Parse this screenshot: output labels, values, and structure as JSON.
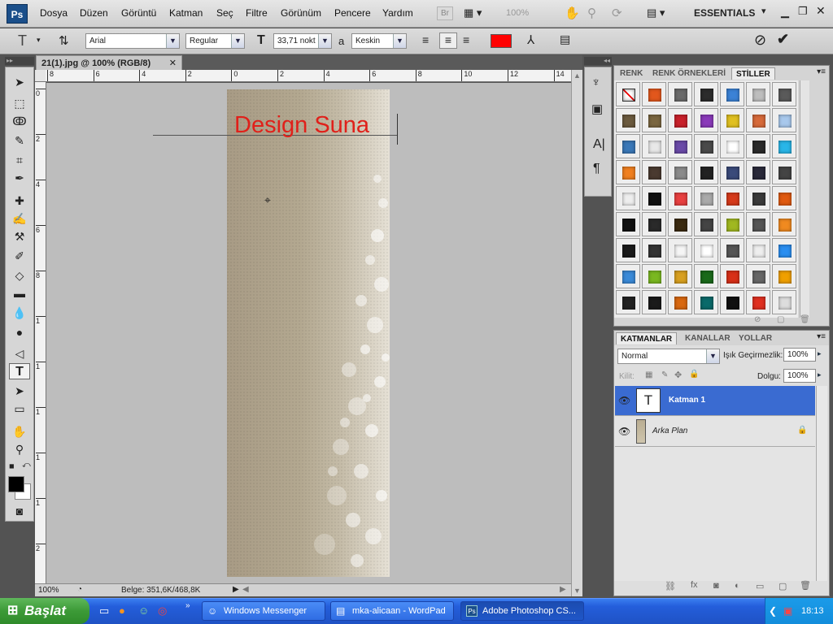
{
  "menubar": {
    "logo": "Ps",
    "items": [
      "Dosya",
      "Düzen",
      "Görüntü",
      "Katman",
      "Seç",
      "Filtre",
      "Görünüm",
      "Pencere",
      "Yardım"
    ],
    "zoom": "100%",
    "workspace": "ESSENTIALS"
  },
  "options": {
    "font_family": "Arial",
    "font_style": "Regular",
    "font_size": "33,71 nokt",
    "antialias_label": "a",
    "antialias": "Keskin",
    "text_color": "#ff0000"
  },
  "document": {
    "tab_title": "21(1).jpg @ 100% (RGB/8)",
    "overlay_text": "Design Suna",
    "text_color": "#e0201a",
    "h_ruler": [
      "8",
      "6",
      "4",
      "2",
      "0",
      "2",
      "4",
      "6",
      "8",
      "10",
      "12",
      "14"
    ],
    "v_ruler": [
      "0",
      "2",
      "4",
      "6",
      "8",
      "1",
      "1",
      "1",
      "1",
      "1",
      "2",
      "2"
    ],
    "zoom": "100%",
    "status": "Belge: 351,6K/468,8K"
  },
  "swatch_panel": {
    "tabs": [
      "RENK",
      "RENK ÖRNEKLERİ",
      "STİLLER"
    ],
    "active_tab": "STİLLER",
    "styles": [
      "#ffffff",
      "#e2571c",
      "#6a6a6a",
      "#2c2c2c",
      "#3b82d6",
      "#bdbdbd",
      "#5a5a5a",
      "#6b5a3e",
      "#7a6640",
      "#c8202a",
      "#8a3ab9",
      "#e0c020",
      "#d66a3a",
      "#a8c8ec",
      "#3a78b8",
      "#e8e8e8",
      "#6a4aa8",
      "#4a4a4a",
      "#ffffff",
      "#2a2a2a",
      "#29b6e8",
      "#f08020",
      "#4a3a30",
      "#8a8a8a",
      "#222222",
      "#3a4a7a",
      "#2a2a3a",
      "#444444",
      "#eeeeee",
      "#111111",
      "#e84040",
      "#aaaaaa",
      "#d63a1a",
      "#3a3a3a",
      "#e05a10",
      "#111111",
      "#2a2a2a",
      "#3a2a10",
      "#444444",
      "#a0b820",
      "#555555",
      "#f08a20",
      "#1a1a1a",
      "#333333",
      "#f5f5f5",
      "#ffffff",
      "#555555",
      "#eeeeee",
      "#2a8ef0",
      "#3a8ad8",
      "#7ab820",
      "#d8a020",
      "#1a6a1a",
      "#d83018",
      "#666666",
      "#f0a000",
      "#222222",
      "#1a1a1a",
      "#d86810",
      "#0a6a6a",
      "#111111",
      "#e03020",
      "#dddddd"
    ]
  },
  "layers_panel": {
    "tabs": [
      "KATMANLAR",
      "KANALLAR",
      "YOLLAR"
    ],
    "blend_mode": "Normal",
    "opacity_label": "Işık Geçirmezlik:",
    "opacity": "100%",
    "lock_label": "Kilit:",
    "fill_label": "Dolgu:",
    "fill": "100%",
    "layers": [
      {
        "name": "Katman 1",
        "thumb": "T",
        "selected": true
      },
      {
        "name": "Arka Plan",
        "thumb": "",
        "selected": false
      }
    ]
  },
  "taskbar": {
    "start_label": "Başlat",
    "items": [
      "Windows Messenger",
      "mka-alicaan - WordPad",
      "Adobe Photoshop CS..."
    ],
    "active_item": "Adobe Photoshop CS...",
    "clock": "18:13"
  }
}
